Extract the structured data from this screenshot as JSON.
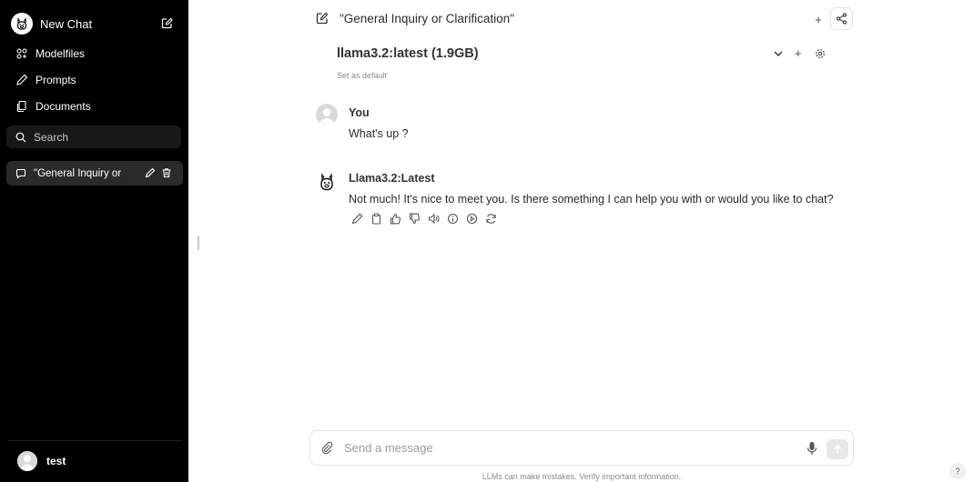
{
  "sidebar": {
    "new_chat_label": "New Chat",
    "items": [
      {
        "label": "Modelfiles",
        "icon": "modelfiles-icon"
      },
      {
        "label": "Prompts",
        "icon": "pencil-icon"
      },
      {
        "label": "Documents",
        "icon": "documents-icon"
      }
    ],
    "search_placeholder": "Search",
    "chats": [
      {
        "title": "\"General Inquiry or"
      }
    ],
    "user_name": "test"
  },
  "header": {
    "chat_title": "\"General Inquiry or Clarification\""
  },
  "model": {
    "name": "llama3.2:latest (1.9GB)",
    "set_default": "Set as default"
  },
  "messages": [
    {
      "author": "You",
      "text": "What's up ?"
    },
    {
      "author": "Llama3.2:Latest",
      "text": "Not much! It's nice to meet you. Is there something I can help you with or would you like to chat?"
    }
  ],
  "message_actions": [
    "edit-icon",
    "copy-icon",
    "thumbs-up-icon",
    "thumbs-down-icon",
    "speaker-icon",
    "info-icon",
    "continue-icon",
    "regenerate-icon"
  ],
  "composer": {
    "placeholder": "Send a message"
  },
  "disclaimer": "LLMs can make mistakes. Verify important information.",
  "help_label": "?",
  "colors": {
    "sidebar_bg": "#000000",
    "active_chat_bg": "#2a2a2a",
    "search_bg": "#181818"
  }
}
